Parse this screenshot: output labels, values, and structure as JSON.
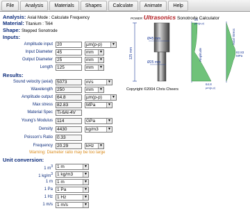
{
  "menu": [
    "File",
    "Analysis",
    "Materials",
    "Shapes",
    "Calculate",
    "Animate",
    "Help"
  ],
  "header": {
    "analysis_label": "Analysis:",
    "analysis_value": "Axial Mode : Calculate Frequency",
    "material_label": "Material:",
    "material_value": "Titanium : Ti64",
    "shape_label": "Shape:",
    "shape_value": "Stepped Sonotrode",
    "inputs_label": "Inputs:"
  },
  "inputs": [
    {
      "label": "Amplitude input",
      "value": "20",
      "unit": "µm(p-p)"
    },
    {
      "label": "Input Diameter",
      "value": "45",
      "unit": "mm"
    },
    {
      "label": "Output Diameter",
      "value": "25",
      "unit": "mm"
    },
    {
      "label": "Length",
      "value": "125",
      "unit": "mm"
    }
  ],
  "results_label": "Results:",
  "results": [
    {
      "label": "Sound velocity (axial)",
      "value": "5073",
      "unit": "m/s"
    },
    {
      "label": "Wavelength",
      "value": "250",
      "unit": "mm"
    },
    {
      "label": "Amplitude output",
      "value": "64.8",
      "unit": "µm(p-p)"
    },
    {
      "label": "Max stress",
      "value": "82.83",
      "unit": "MPa"
    },
    {
      "label": "Material Spec",
      "value": "Ti-6Al-4V",
      "unit": ""
    },
    {
      "label": "Young's Modulus",
      "value": "114",
      "unit": "GPa"
    },
    {
      "label": "Density",
      "value": "4430",
      "unit": "kg/m3"
    },
    {
      "label": "Poisson's Ratio",
      "value": "0.33",
      "unit": ""
    },
    {
      "label": "Frequency",
      "value": "20.29",
      "unit": "kHz"
    }
  ],
  "warning": "Warning: Diameter ratio may be too large",
  "unit_conversion_label": "Unit conversion:",
  "conversions": [
    {
      "label": "1 m",
      "sup": "3",
      "value": "1 m"
    },
    {
      "label": "1 kg/m",
      "sup": "3",
      "value": "1 kg/m3"
    },
    {
      "label": "1 m",
      "sup": "",
      "value": "1 m"
    },
    {
      "label": "1 Pa",
      "sup": "",
      "value": "1 Pa"
    },
    {
      "label": "1 Hz",
      "sup": "",
      "value": "1 Hz"
    },
    {
      "label": "1 m/s",
      "sup": "",
      "value": "1 m/s"
    }
  ],
  "diagram": {
    "power": "POWER",
    "brand": "Ultrasonics",
    "title": "Sonotrode Calculator",
    "dim_length": "125 mm",
    "dim_input": "Ø45 mm",
    "dim_output": "Ø25 mm",
    "amp_in": "20",
    "amp_in_unit": "µm(p-p)",
    "amp_out": "64.8",
    "amp_out_unit": "µm(p-p)",
    "amplitude_label": "Amplitude",
    "stress_label": "Axial Stress",
    "stress_value": "82.83",
    "stress_unit": "MPa",
    "copyright": "Copyright ©2004 Chris Cheers"
  }
}
